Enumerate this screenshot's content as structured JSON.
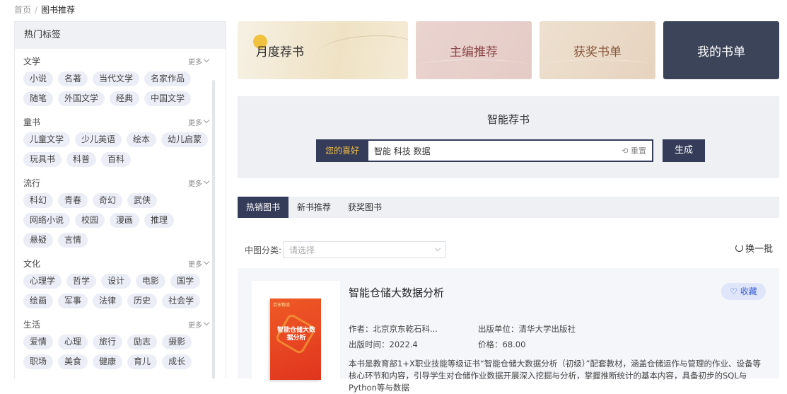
{
  "breadcrumb": {
    "home": "首页",
    "sep": "/",
    "current": "图书推荐"
  },
  "sidebar": {
    "title": "热门标签",
    "more_label": "更多",
    "categories": [
      {
        "title": "文学",
        "tags": [
          "小说",
          "名著",
          "当代文学",
          "名家作品",
          "随笔",
          "外国文学",
          "经典",
          "中国文学"
        ]
      },
      {
        "title": "童书",
        "tags": [
          "儿童文学",
          "少儿英语",
          "绘本",
          "幼儿启蒙",
          "玩具书",
          "科普",
          "百科"
        ]
      },
      {
        "title": "流行",
        "tags": [
          "科幻",
          "青春",
          "奇幻",
          "武侠",
          "网络小说",
          "校园",
          "漫画",
          "推理",
          "悬疑",
          "言情"
        ]
      },
      {
        "title": "文化",
        "tags": [
          "心理学",
          "哲学",
          "设计",
          "电影",
          "国学",
          "绘画",
          "军事",
          "法律",
          "历史",
          "社会学"
        ]
      },
      {
        "title": "生活",
        "tags": [
          "爱情",
          "心理",
          "旅行",
          "励志",
          "摄影",
          "职场",
          "美食",
          "健康",
          "育儿",
          "成长"
        ]
      }
    ]
  },
  "banners": [
    "月度荐书",
    "主编推荐",
    "获奖书单",
    "我的书单"
  ],
  "smart": {
    "title": "智能荐书",
    "pref_label": "您的喜好",
    "pref_value": "智能 科技 数据",
    "reset_label": "重置",
    "generate_label": "生成"
  },
  "tabs": [
    "热销图书",
    "新书推荐",
    "获奖图书"
  ],
  "filter": {
    "label": "中图分类:",
    "placeholder": "请选择"
  },
  "refresh_label": "换一批",
  "book": {
    "title": "智能仓储大数据分析",
    "fav_label": "收藏",
    "author": "作者：北京京东乾石科...",
    "publisher": "出版单位：清华大学出版社",
    "date": "出版时间：2022.4",
    "price": "价格：68.00",
    "description": "本书是教育部1+X职业技能等级证书“智能仓储大数据分析（初级）”配套教材，涵盖仓储运作与管理的作业、设备等核心环节和内容，引导学生对仓储作业数据开展深入挖掘与分析，掌握推断统计的基本内容，具备初步的SQL与Python等与数据",
    "cover_top": "京东物流",
    "cover_title": "智能仓储大数据分析"
  },
  "colors": {
    "navy": "#353c5a",
    "accent_yellow": "#f5c040",
    "tag_bg": "#eceef7",
    "fav_blue": "#3a5bd0"
  }
}
